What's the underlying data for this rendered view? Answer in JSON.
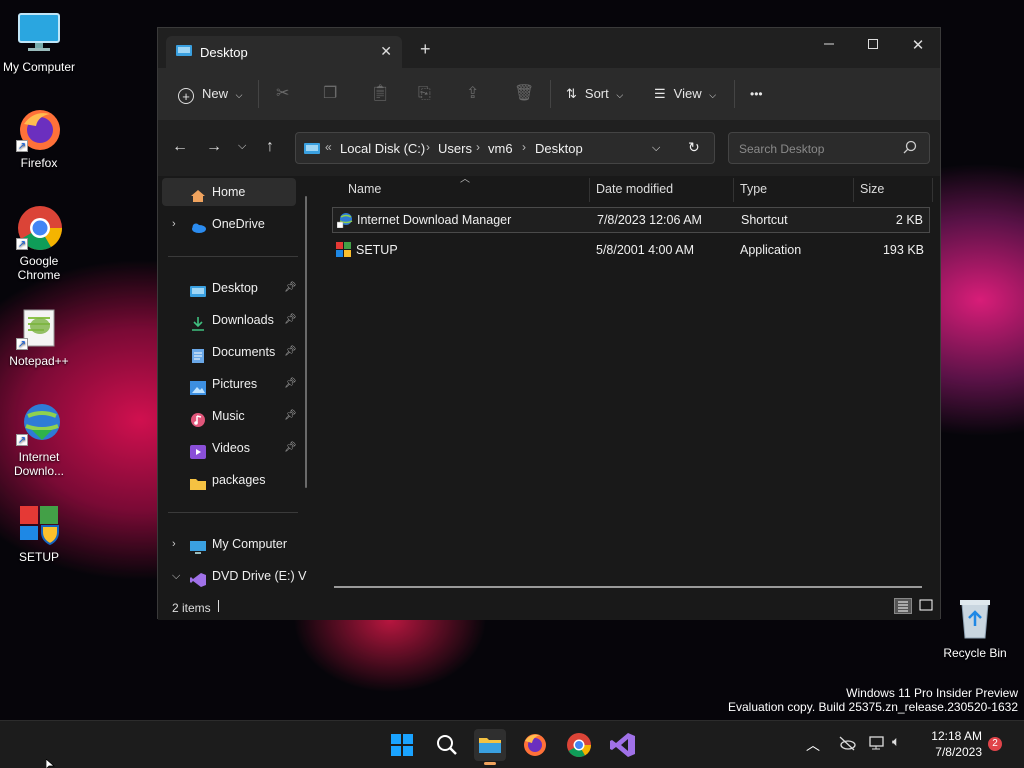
{
  "desktop": {
    "icons": [
      {
        "label": "My Computer"
      },
      {
        "label": "Firefox"
      },
      {
        "label": "Google Chrome"
      },
      {
        "label": "Notepad++"
      },
      {
        "label": "Internet Downlo..."
      },
      {
        "label": "SETUP"
      },
      {
        "label": "Recycle Bin"
      }
    ],
    "watermark_line1": "Windows 11 Pro Insider Preview",
    "watermark_line2": "Evaluation copy. Build 25375.zn_release.230520-1632"
  },
  "window": {
    "tab_title": "Desktop",
    "toolbar": {
      "new_label": "New",
      "sort_label": "Sort",
      "view_label": "View",
      "more_label": "•••"
    },
    "address": {
      "overflow": "«",
      "crumbs": [
        "Local Disk (C:)",
        "Users",
        "vm6",
        "Desktop"
      ]
    },
    "search_placeholder": "Search Desktop",
    "nav": {
      "home": "Home",
      "onedrive": "OneDrive",
      "quick": [
        "Desktop",
        "Downloads",
        "Documents",
        "Pictures",
        "Music",
        "Videos",
        "packages"
      ],
      "my_computer": "My Computer",
      "dvd": "DVD Drive (E:) V"
    },
    "columns": {
      "name": "Name",
      "date": "Date modified",
      "type": "Type",
      "size": "Size"
    },
    "files": [
      {
        "name": "Internet Download Manager",
        "date": "7/8/2023 12:06 AM",
        "type": "Shortcut",
        "size": "2 KB"
      },
      {
        "name": "SETUP",
        "date": "5/8/2001 4:00 AM",
        "type": "Application",
        "size": "193 KB"
      }
    ],
    "status": "2 items"
  },
  "taskbar": {
    "time": "12:18 AM",
    "date": "7/8/2023",
    "notification_count": "2"
  },
  "colors": {
    "accent": "#0078d4",
    "window_bg": "#191919",
    "toolbar_bg": "#2b2b2b"
  }
}
